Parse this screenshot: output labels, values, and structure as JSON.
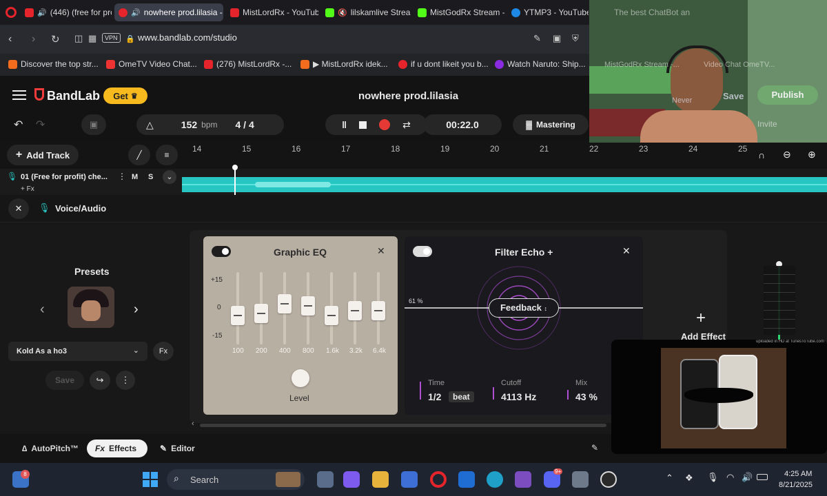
{
  "tabs": [
    {
      "label": "(446) (free for pro",
      "color": "#e5242b"
    },
    {
      "label": "nowhere prod.lilasia -",
      "color": "#e5242b"
    },
    {
      "label": "MistLordRx - YouTube",
      "color": "#e5242b"
    },
    {
      "label": "lilskamlive Stream",
      "color": "#53fc18"
    },
    {
      "label": "MistGodRx Stream - V",
      "color": "#53fc18"
    },
    {
      "label": "YTMP3 - YouTube to",
      "color": "#1e88e5"
    },
    {
      "label": "The best ChatBot an",
      "color": "#888888"
    }
  ],
  "address": {
    "url": "www.bandlab.com/studio",
    "vpn": "VPN"
  },
  "bookmarks": [
    {
      "label": "Discover the top str...",
      "color": "#f46c1e"
    },
    {
      "label": "OmeTV Video Chat...",
      "color": "#e33"
    },
    {
      "label": "(276) MistLordRx -...",
      "color": "#e5242b"
    },
    {
      "label": "▶ MistLordRx idek...",
      "color": "#f46c1e"
    },
    {
      "label": "if u dont likeit you b...",
      "color": "#e5242b"
    },
    {
      "label": "Watch Naruto: Ship...",
      "color": "#8a2be2"
    },
    {
      "label": "MistGodRx Stream -...",
      "color": "#53fc18"
    },
    {
      "label": "Video Chat OmeTV...",
      "color": "#e33"
    }
  ],
  "header": {
    "brand": "BandLab",
    "get": "Get",
    "project_title": "nowhere prod.lilasia",
    "save": "Save",
    "publish": "Publish",
    "invite": "Invite",
    "never": "Never"
  },
  "transport": {
    "bpm": "152",
    "bpm_unit": "bpm",
    "signature": "4 / 4",
    "time": "00:22.0",
    "mastering": "Mastering"
  },
  "timeline": {
    "add_track": "Add Track",
    "ticks": [
      "14",
      "15",
      "16",
      "17",
      "18",
      "19",
      "20",
      "21",
      "22",
      "23",
      "24",
      "25"
    ]
  },
  "track": {
    "name": "01  (Free for profit) che...",
    "mute": "M",
    "solo": "S",
    "fx": "+ Fx"
  },
  "voice": {
    "title": "Voice/Audio"
  },
  "presets": {
    "title": "Presets",
    "selected": "Kold As a ho3",
    "save": "Save"
  },
  "eq": {
    "title": "Graphic EQ",
    "scale_top": "+15",
    "scale_mid": "0",
    "scale_bot": "-15",
    "bands": [
      {
        "freq": "100",
        "gain": -3
      },
      {
        "freq": "200",
        "gain": -2
      },
      {
        "freq": "400",
        "gain": 2
      },
      {
        "freq": "800",
        "gain": 1
      },
      {
        "freq": "1.6k",
        "gain": -3
      },
      {
        "freq": "3.2k",
        "gain": -1
      },
      {
        "freq": "6.4k",
        "gain": -1
      }
    ],
    "level": "Level"
  },
  "echo": {
    "title": "Filter Echo +",
    "percent": "61 %",
    "feedback": "Feedback",
    "time_label": "Time",
    "time_value": "1/2",
    "time_unit": "beat",
    "cutoff_label": "Cutoff",
    "cutoff_value": "4113 Hz",
    "mix_label": "Mix",
    "mix_value": "43 %"
  },
  "add_effect": "Add Effect",
  "pip_caption": "uploaded in HD at TunesToTube.com",
  "bottom_tabs": {
    "autopitch": "AutoPitch™",
    "effects": "Effects",
    "editor": "Editor"
  },
  "taskbar": {
    "search": "Search",
    "time": "4:25 AM",
    "date": "8/21/2025",
    "badge_discord": "9+",
    "badge_left": "8"
  }
}
